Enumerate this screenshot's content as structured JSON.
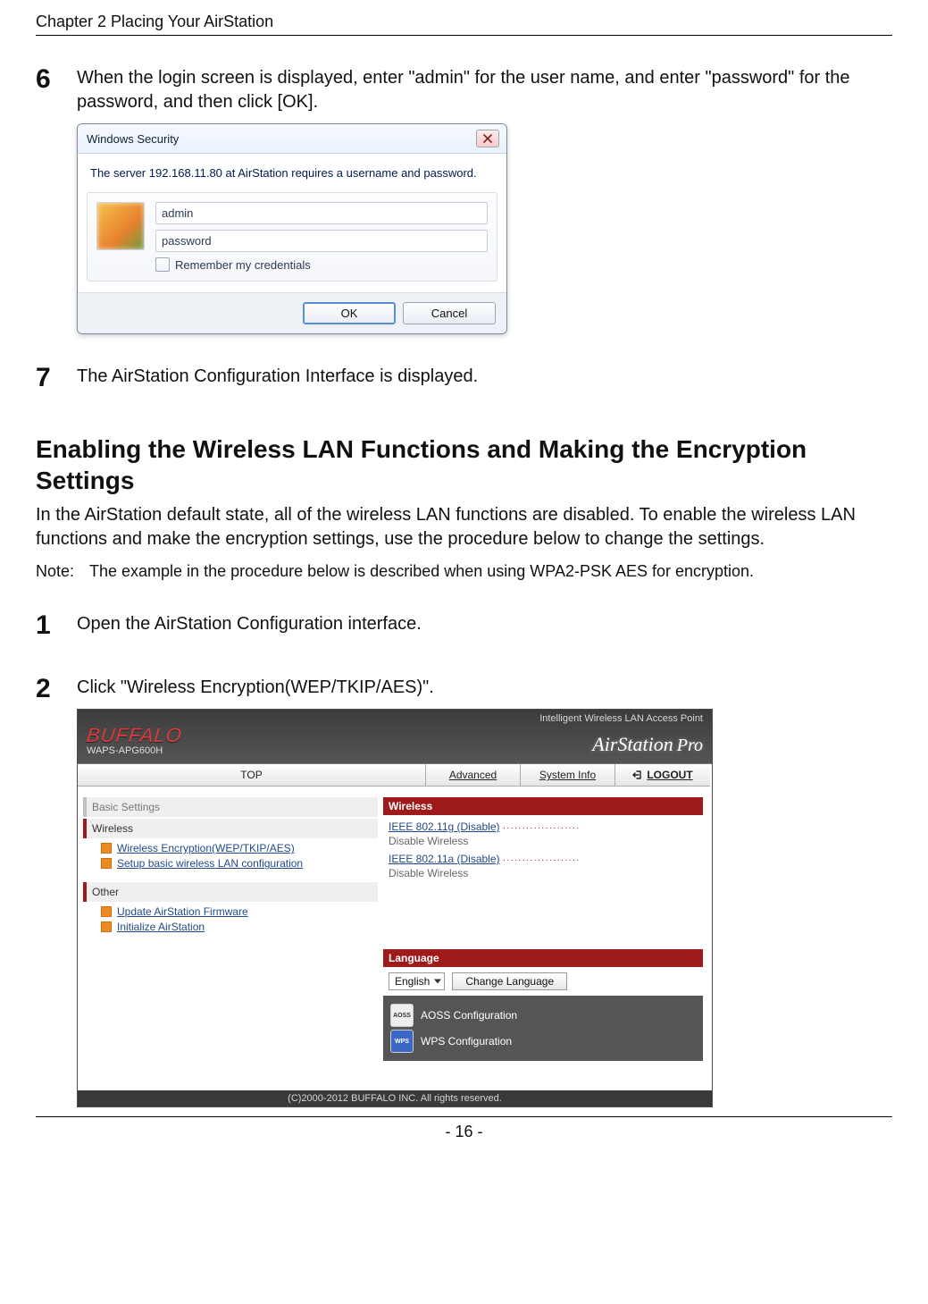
{
  "chapter_header": "Chapter 2  Placing Your AirStation",
  "step6": {
    "num": "6",
    "text": "When the login screen is displayed, enter \"admin\" for the user name, and enter \"password\" for the password, and then click [OK]."
  },
  "dialog": {
    "title": "Windows Security",
    "message": "The server 192.168.11.80 at AirStation requires a username and password.",
    "username_value": "admin",
    "password_value": "password",
    "remember_label": "Remember my credentials",
    "ok_label": "OK",
    "cancel_label": "Cancel"
  },
  "step7": {
    "num": "7",
    "text": "The AirStation Configuration Interface is displayed."
  },
  "section": {
    "title": "Enabling the Wireless LAN Functions and Making the Encryption Settings",
    "intro": "In the AirStation default state, all of the wireless LAN functions are disabled. To enable the wireless LAN functions and make the encryption settings, use the procedure below to change the settings.",
    "note_label": "Note:",
    "note_body": "The example in the procedure below is described when using WPA2-PSK AES for encryption."
  },
  "step1": {
    "num": "1",
    "text": "Open the AirStation Configuration interface."
  },
  "step2": {
    "num": "2",
    "text": "Click \"Wireless Encryption(WEP/TKIP/AES)\"."
  },
  "airstation": {
    "tagline": "Intelligent Wireless LAN Access Point",
    "brand": "BUFFALO",
    "model": "WAPS-APG600H",
    "air_label": "AirStation",
    "air_pro": "Pro",
    "tabs": {
      "top": "TOP",
      "advanced": "Advanced",
      "sysinfo": "System Info",
      "logout": "LOGOUT"
    },
    "left": {
      "basic_header": "Basic Settings",
      "wireless_header": "Wireless",
      "wireless_links": [
        "Wireless Encryption(WEP/TKIP/AES)",
        "Setup basic wireless LAN configuration"
      ],
      "other_header": "Other",
      "other_links": [
        "Update AirStation Firmware",
        "Initialize AirStation"
      ]
    },
    "right": {
      "wireless_title": "Wireless",
      "row_g_link": "IEEE 802.11g (Disable)",
      "row_g_sub": "Disable Wireless",
      "row_a_link": "IEEE 802.11a (Disable)",
      "row_a_sub": "Disable Wireless",
      "language_title": "Language",
      "language_value": "English",
      "change_language_btn": "Change Language",
      "aoss_icon": "AOSS",
      "aoss_label": "AOSS Configuration",
      "wps_icon": "WPS",
      "wps_label": "WPS Configuration"
    },
    "footer": "(C)2000-2012 BUFFALO INC. All rights reserved."
  },
  "page_number": "- 16 -"
}
